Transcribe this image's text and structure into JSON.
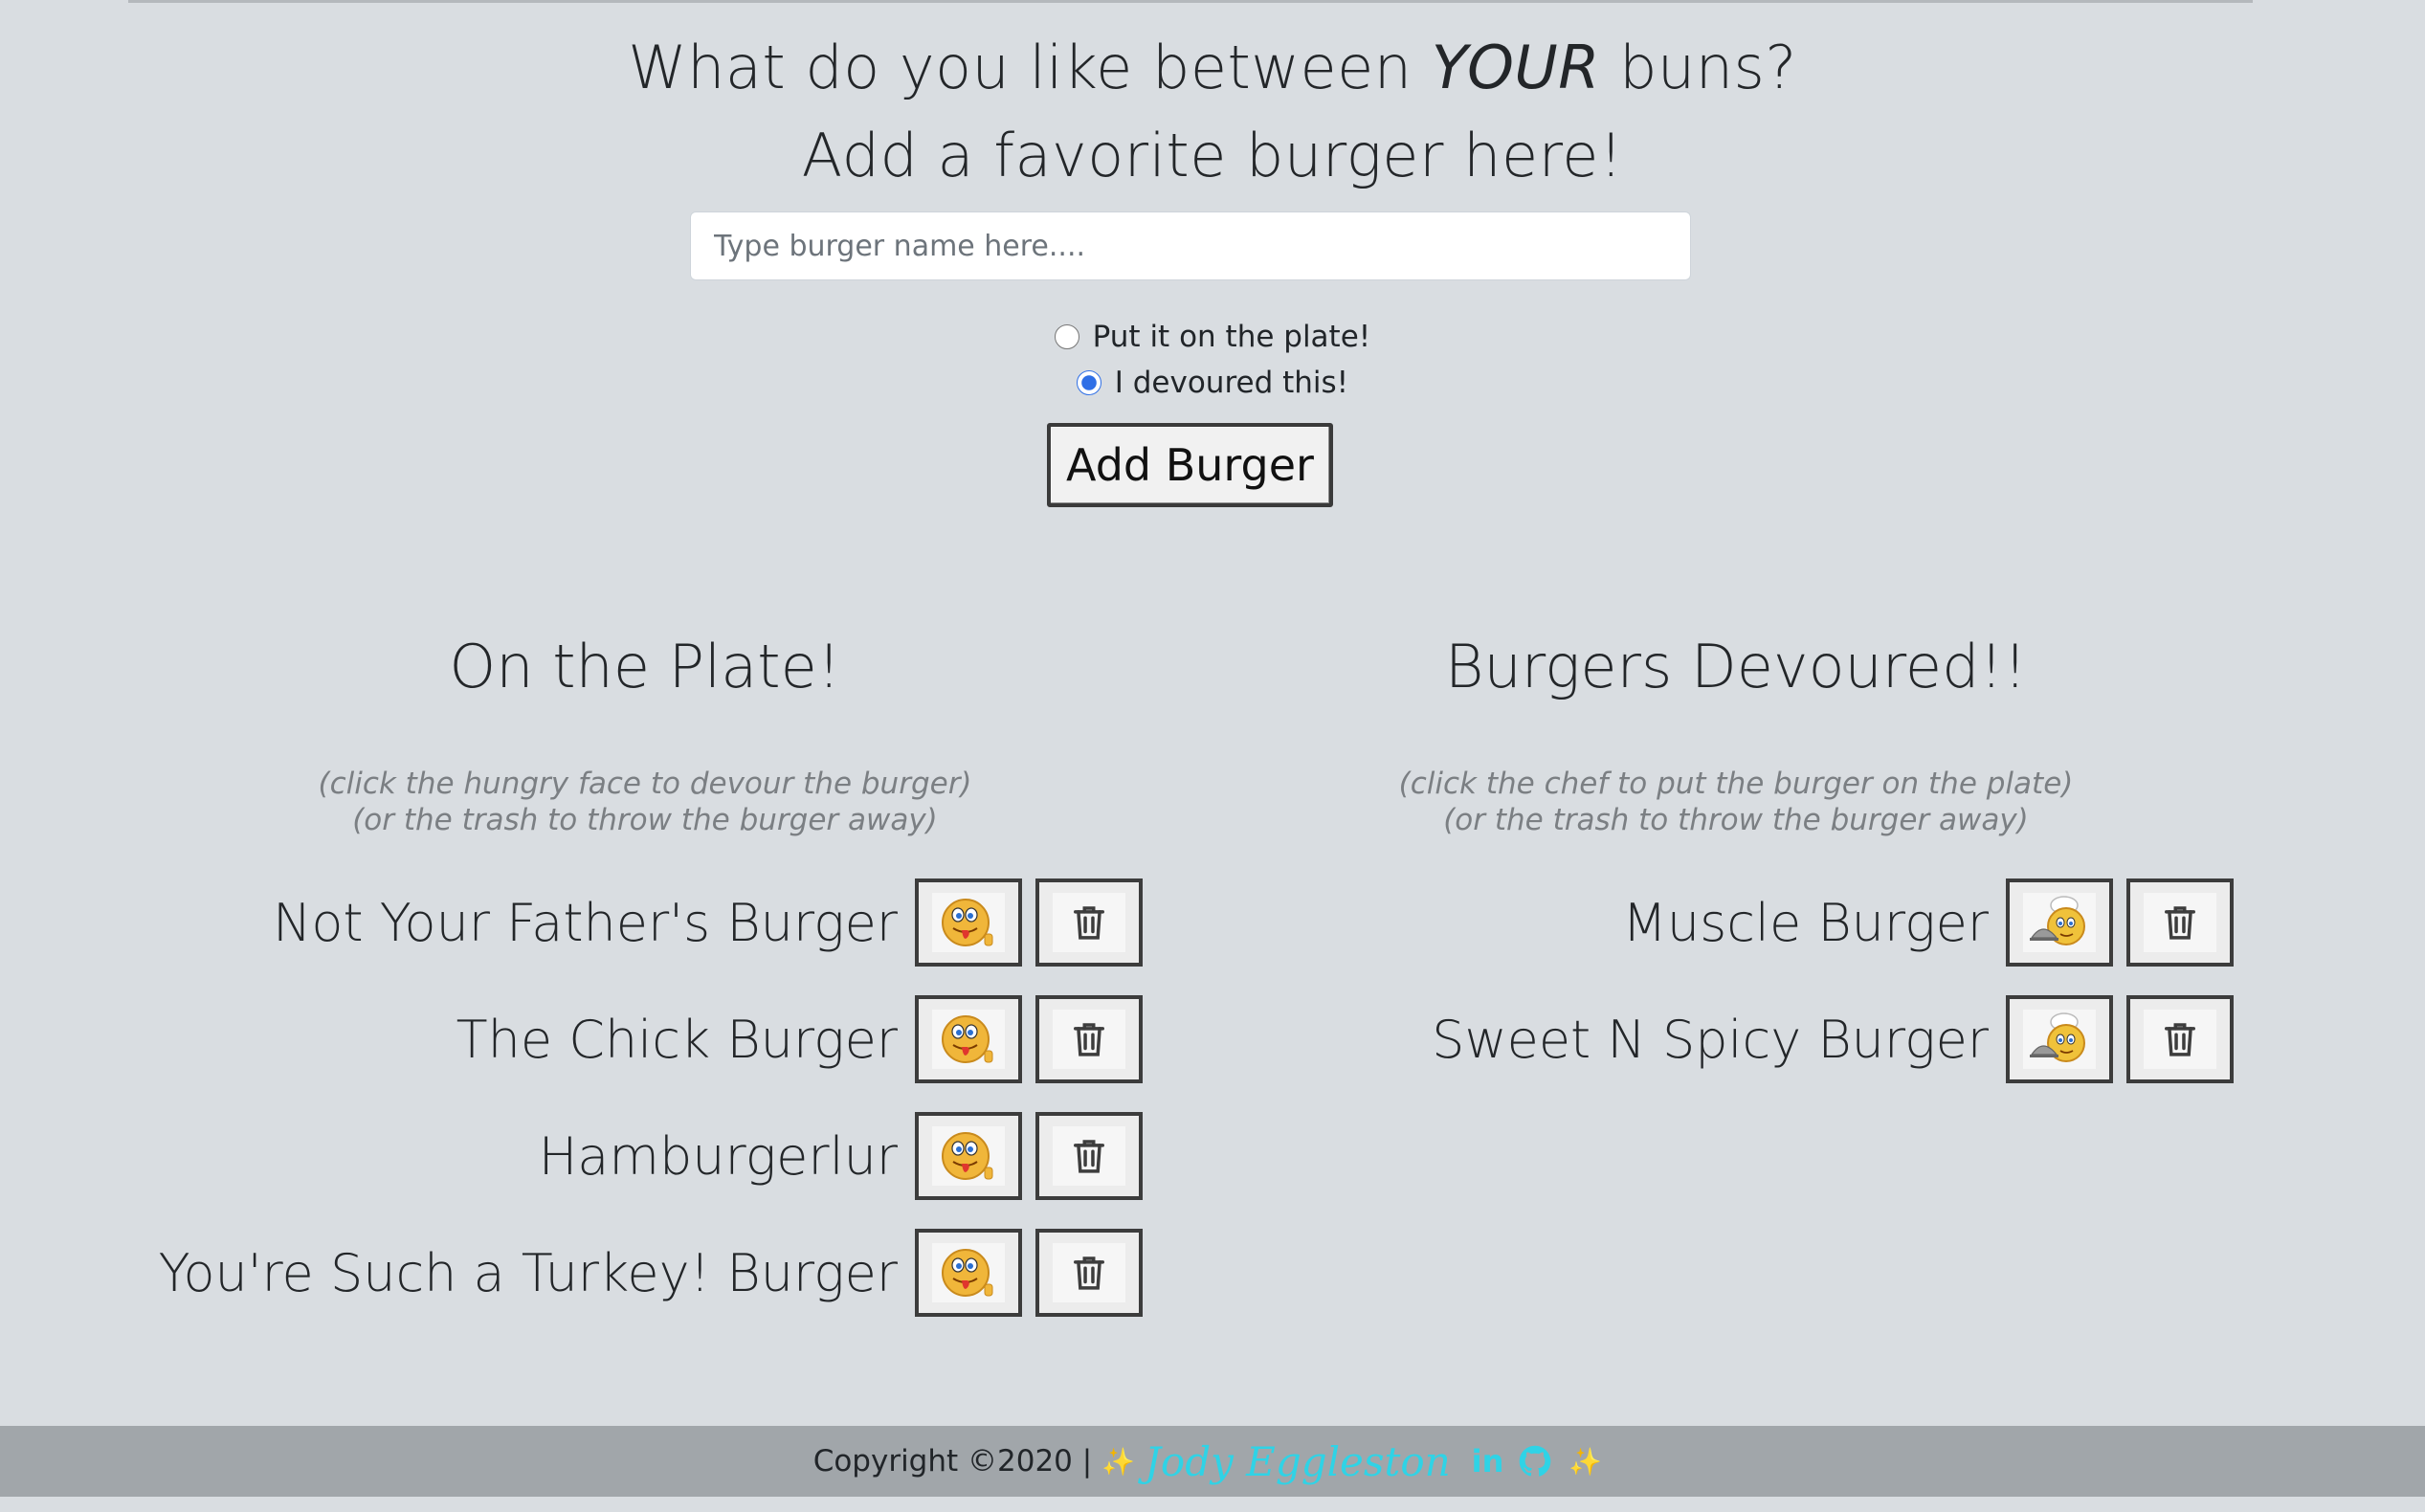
{
  "header": {
    "line1_before": "What do you like between ",
    "line1_emphasis": "YOUR",
    "line1_after": " buns?",
    "line2": "Add a favorite burger here!"
  },
  "form": {
    "input_placeholder": "Type burger name here....",
    "input_value": "",
    "radio_plate_label": "Put it on the plate!",
    "radio_devoured_label": "I devoured this!",
    "selected_radio": "devoured",
    "submit_label": "Add Burger"
  },
  "plate": {
    "title": "On the Plate!",
    "hint_line1": "(click the hungry face to devour the burger)",
    "hint_line2": "(or the trash to throw the burger away)",
    "action_icon": "hungry-face-icon",
    "burgers": [
      "Not Your Father's Burger",
      "The Chick Burger",
      "Hamburgerlur",
      "You're Such a Turkey! Burger"
    ]
  },
  "devoured": {
    "title": "Burgers Devoured!!",
    "hint_line1": "(click the chef to put the burger on the plate)",
    "hint_line2": "(or the trash to throw the burger away)",
    "action_icon": "chef-icon",
    "burgers": [
      "Muscle Burger",
      "Sweet N Spicy Burger"
    ]
  },
  "footer": {
    "copyright": "Copyright ©2020 |",
    "author": "Jody Eggleston",
    "linkedin_label": "in",
    "accent_color": "#2fd3e6"
  }
}
